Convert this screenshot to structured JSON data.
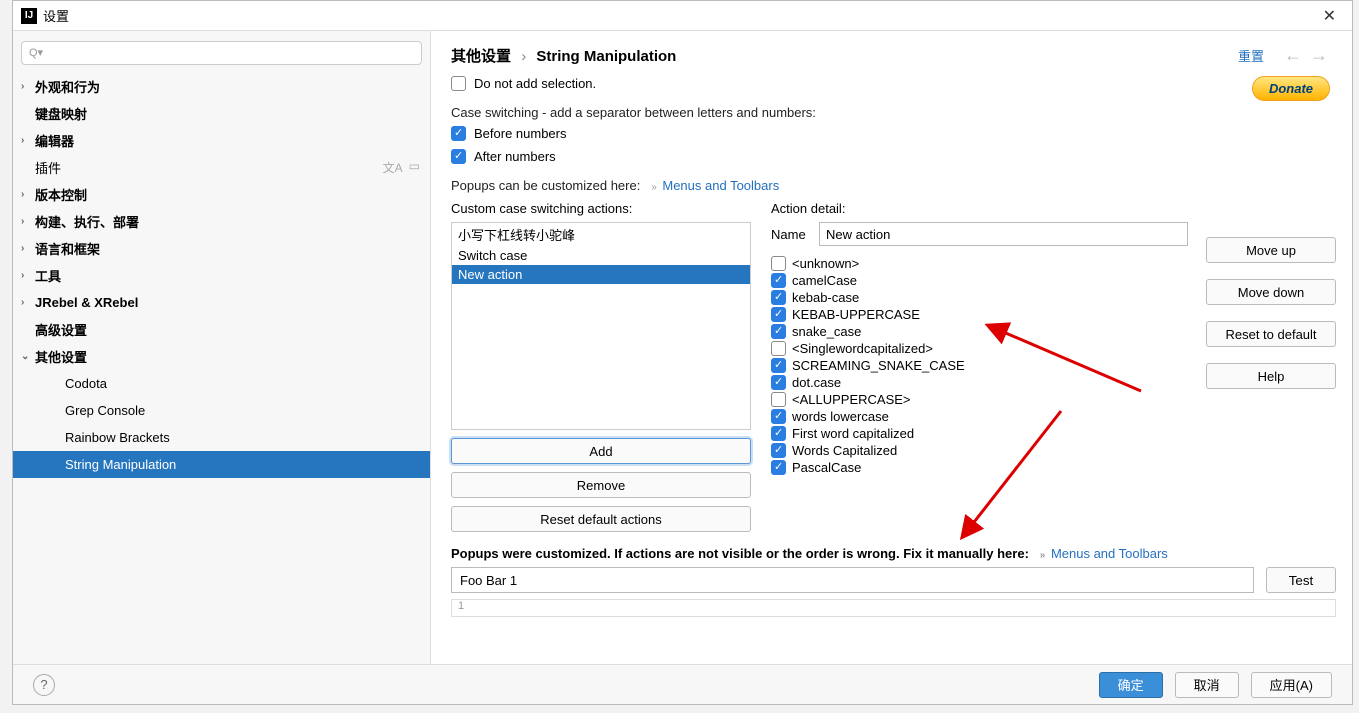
{
  "window": {
    "title": "设置"
  },
  "sidebar": {
    "search_placeholder": "",
    "items": [
      {
        "label": "外观和行为",
        "chevron": ">",
        "bold": true
      },
      {
        "label": "键盘映射",
        "bold": true
      },
      {
        "label": "编辑器",
        "chevron": ">",
        "bold": true
      },
      {
        "label": "插件",
        "extra": true
      },
      {
        "label": "版本控制",
        "chevron": ">",
        "bold": true
      },
      {
        "label": "构建、执行、部署",
        "chevron": ">",
        "bold": true
      },
      {
        "label": "语言和框架",
        "chevron": ">",
        "bold": true
      },
      {
        "label": "工具",
        "chevron": ">",
        "bold": true
      },
      {
        "label": "JRebel & XRebel",
        "chevron": ">",
        "bold": true
      },
      {
        "label": "高级设置",
        "bold": true
      },
      {
        "label": "其他设置",
        "chevron": "v",
        "bold": true
      },
      {
        "label": "Codota",
        "lvl": 2
      },
      {
        "label": "Grep Console",
        "lvl": 2
      },
      {
        "label": "Rainbow Brackets",
        "lvl": 2
      },
      {
        "label": "String Manipulation",
        "lvl": 2,
        "selected": true
      }
    ]
  },
  "header": {
    "bc1": "其他设置",
    "bc2": "String Manipulation",
    "reset": "重置"
  },
  "content": {
    "do_not_add": "Do not add selection.",
    "donate": "Donate",
    "case_switch_label": "Case switching - add a separator between letters and numbers:",
    "before": "Before numbers",
    "after": "After numbers",
    "popups_label": "Popups can be customized here:",
    "menus_link": "Menus and Toolbars",
    "custom_label": "Custom case switching actions:",
    "actions": [
      {
        "label": "小写下杠线转小驼峰"
      },
      {
        "label": "Switch case"
      },
      {
        "label": "New action",
        "selected": true
      }
    ],
    "btn_add": "Add",
    "btn_remove": "Remove",
    "btn_reset": "Reset default actions",
    "detail_label": "Action detail:",
    "name_label": "Name",
    "name_value": "New action",
    "styles": [
      {
        "label": "<unknown>",
        "checked": false
      },
      {
        "label": "camelCase",
        "checked": true
      },
      {
        "label": "kebab-case",
        "checked": true
      },
      {
        "label": "KEBAB-UPPERCASE",
        "checked": true
      },
      {
        "label": "snake_case",
        "checked": true
      },
      {
        "label": "<Singlewordcapitalized>",
        "checked": false
      },
      {
        "label": "SCREAMING_SNAKE_CASE",
        "checked": true
      },
      {
        "label": "dot.case",
        "checked": true
      },
      {
        "label": "<ALLUPPERCASE>",
        "checked": false
      },
      {
        "label": "words lowercase",
        "checked": true
      },
      {
        "label": "First word capitalized",
        "checked": true
      },
      {
        "label": "Words Capitalized",
        "checked": true
      },
      {
        "label": "PascalCase",
        "checked": true
      }
    ],
    "btn_moveup": "Move up",
    "btn_movedown": "Move down",
    "btn_resetdef": "Reset to default",
    "btn_help": "Help",
    "warn": "Popups were customized. If actions are not visible or the order is wrong. Fix it manually here:",
    "menus_link2": "Menus and Toolbars",
    "test_value": "Foo Bar 1",
    "test_btn": "Test",
    "result": "1"
  },
  "footer": {
    "ok": "确定",
    "cancel": "取消",
    "apply": "应用(A)"
  }
}
